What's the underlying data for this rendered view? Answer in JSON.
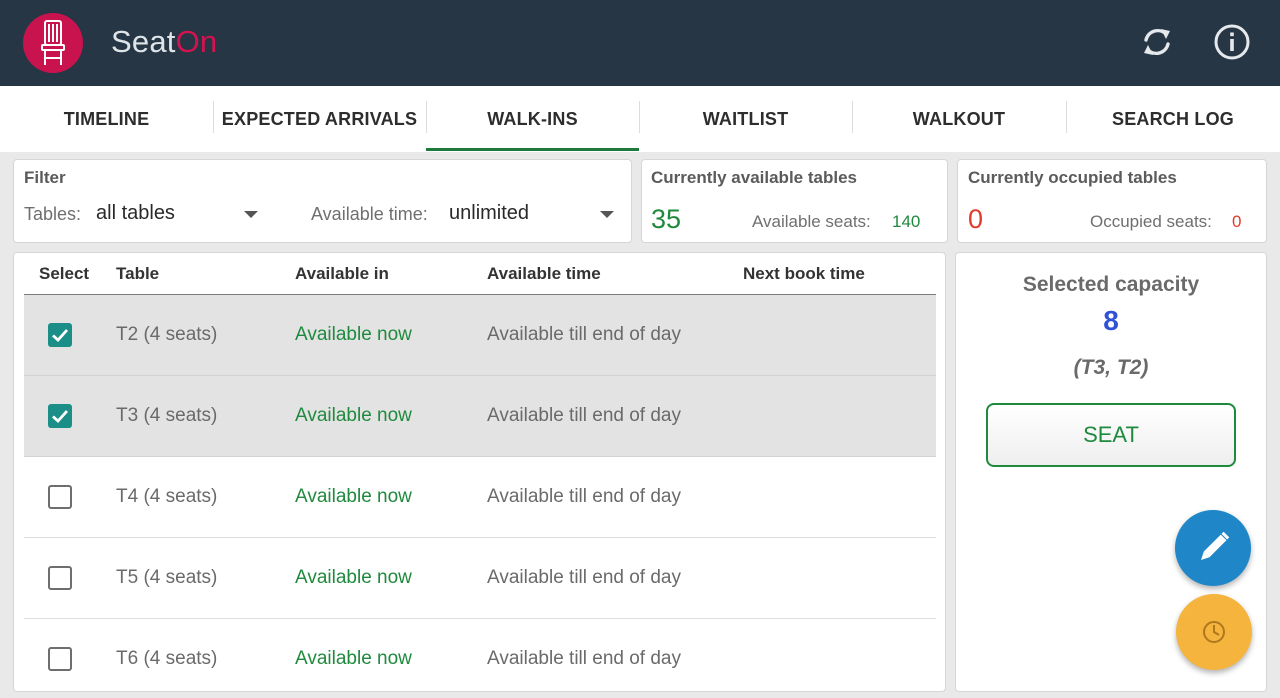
{
  "app": {
    "brand_main": "Seat",
    "brand_accent": "On",
    "logo_icon": "chair-icon",
    "refresh_icon": "refresh-icon",
    "info_icon": "info-icon",
    "colors": {
      "header": "#263645",
      "accent": "#d3134f",
      "green": "#1f8a3e",
      "blue": "#2f52d6",
      "red": "#e23b2d"
    }
  },
  "tabs": [
    {
      "label": "TIMELINE"
    },
    {
      "label": "EXPECTED ARRIVALS"
    },
    {
      "label": "WALK-INS",
      "active": true
    },
    {
      "label": "WAITLIST"
    },
    {
      "label": "WALKOUT"
    },
    {
      "label": "SEARCH LOG"
    }
  ],
  "filter": {
    "title": "Filter",
    "tables_label": "Tables:",
    "tables_value": "all tables",
    "time_label": "Available time:",
    "time_value": "unlimited"
  },
  "available": {
    "title": "Currently available tables",
    "count": "35",
    "seats_label": "Available seats:",
    "seats_value": "140"
  },
  "occupied": {
    "title": "Currently occupied tables",
    "count": "0",
    "seats_label": "Occupied seats:",
    "seats_value": "0"
  },
  "table": {
    "headers": [
      "Select",
      "Table",
      "Available in",
      "Available time",
      "Next book time"
    ],
    "rows": [
      {
        "checked": true,
        "table": "T2 (4 seats)",
        "available_in": "Available now",
        "available_time": "Available till end of day",
        "next_book": ""
      },
      {
        "checked": true,
        "table": "T3 (4 seats)",
        "available_in": "Available now",
        "available_time": "Available till end of day",
        "next_book": ""
      },
      {
        "checked": false,
        "table": "T4 (4 seats)",
        "available_in": "Available now",
        "available_time": "Available till end of day",
        "next_book": ""
      },
      {
        "checked": false,
        "table": "T5 (4 seats)",
        "available_in": "Available now",
        "available_time": "Available till end of day",
        "next_book": ""
      },
      {
        "checked": false,
        "table": "T6 (4 seats)",
        "available_in": "Available now",
        "available_time": "Available till end of day",
        "next_book": ""
      }
    ]
  },
  "capacity": {
    "title": "Selected capacity",
    "value": "8",
    "tables": "(T3, T2)",
    "seat_label": "SEAT"
  },
  "fabs": {
    "edit_icon": "pencil-icon",
    "clock_icon": "clock-icon"
  }
}
